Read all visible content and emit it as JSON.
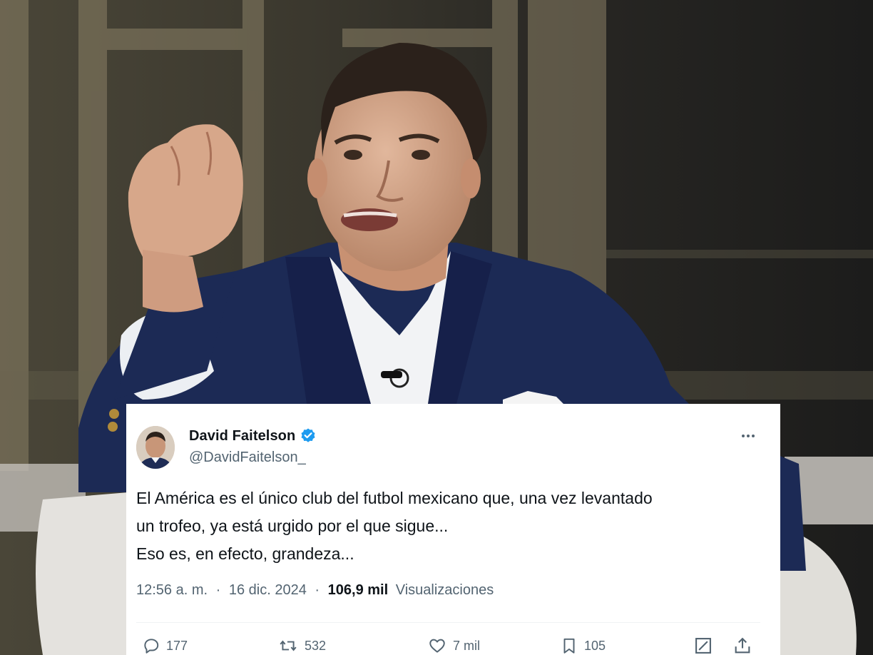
{
  "tweet": {
    "author_name": "David Faitelson",
    "author_handle": "@DavidFaitelson_",
    "text_lines": [
      "El América es el único club del futbol mexicano que, una vez levantado",
      "un trofeo, ya está urgido por el que sigue...",
      "Eso es, en efecto, grandeza..."
    ],
    "time": "12:56 a. m.",
    "separator": "·",
    "date": "16 dic. 2024",
    "views_count": "106,9 mil",
    "views_label": "Visualizaciones",
    "actions": {
      "replies": "177",
      "reposts": "532",
      "likes": "7 mil",
      "bookmarks": "105"
    }
  },
  "colors": {
    "verified": "#1d9bf0",
    "text_primary": "#0f1419",
    "text_secondary": "#536471"
  },
  "icons": [
    "verified-badge-icon",
    "more-icon",
    "reply-icon",
    "repost-icon",
    "like-icon",
    "bookmark-icon",
    "edit-icon",
    "share-icon"
  ]
}
